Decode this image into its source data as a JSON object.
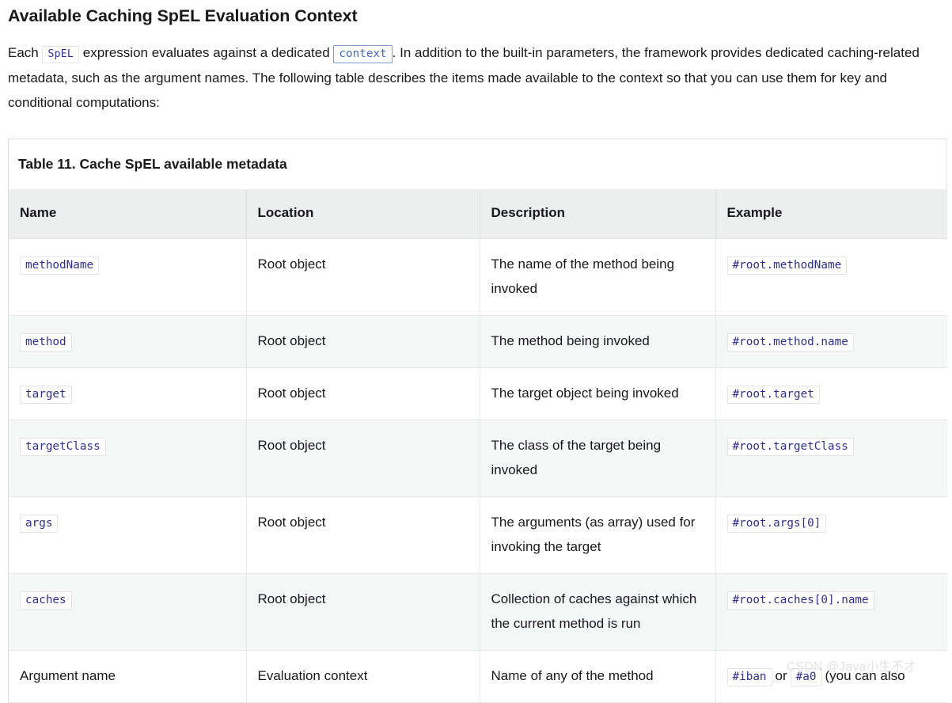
{
  "heading": "Available Caching SpEL Evaluation Context",
  "paragraph": {
    "part1": "Each",
    "code_spel": "SpEL",
    "part2": "expression evaluates against a dedicated",
    "code_context": "context",
    "part3": ". In addition to the built-in parameters, the framework provides dedicated caching-related metadata, such as the argument names. The following table describes the items made available to the context so that you can use them for key and conditional computations:"
  },
  "table": {
    "caption": "Table 11. Cache SpEL available metadata",
    "columns": [
      "Name",
      "Location",
      "Description",
      "Example"
    ],
    "rows": [
      {
        "name": "methodName",
        "name_is_code": true,
        "location": "Root object",
        "description": "The name of the method being invoked",
        "example": "#root.methodName",
        "example_suffix": ""
      },
      {
        "name": "method",
        "name_is_code": true,
        "location": "Root object",
        "description": "The method being invoked",
        "example": "#root.method.name",
        "example_suffix": ""
      },
      {
        "name": "target",
        "name_is_code": true,
        "location": "Root object",
        "description": "The target object being invoked",
        "example": "#root.target",
        "example_suffix": ""
      },
      {
        "name": "targetClass",
        "name_is_code": true,
        "location": "Root object",
        "description": "The class of the target being invoked",
        "example": "#root.targetClass",
        "example_suffix": ""
      },
      {
        "name": "args",
        "name_is_code": true,
        "location": "Root object",
        "description": "The arguments (as array) used for invoking the target",
        "example": "#root.args[0]",
        "example_suffix": ""
      },
      {
        "name": "caches",
        "name_is_code": true,
        "location": "Root object",
        "description": "Collection of caches against which the current method is run",
        "example": "#root.caches[0].name",
        "example_suffix": ""
      },
      {
        "name": "Argument name",
        "name_is_code": false,
        "location": "Evaluation context",
        "description": "Name of any of the method",
        "example": "#iban",
        "example_joiner": "or",
        "example2": "#a0",
        "example_suffix": "(you can also"
      }
    ]
  },
  "watermark": "CSDN @Java小生不才",
  "colors": {
    "text": "#19191c",
    "code_text": "#2f2f8f",
    "code_link_text": "#4b69b6",
    "code_link_border": "#7a9ccc",
    "header_bg": "#ecefee",
    "row_alt_bg": "#f5f7f6",
    "border": "#dedede",
    "watermark": "#e2e2e2"
  }
}
